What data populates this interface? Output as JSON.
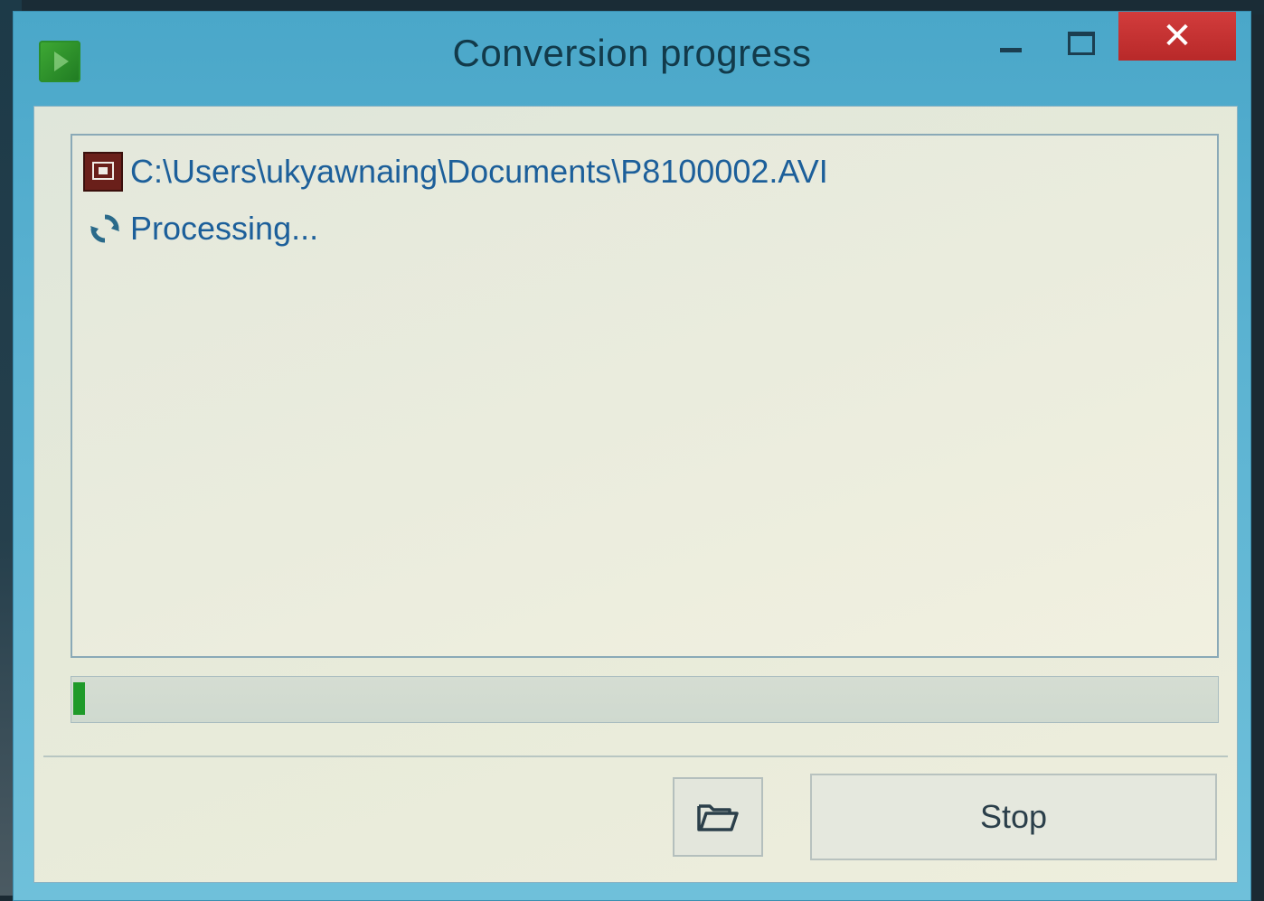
{
  "window": {
    "title": "Conversion progress",
    "close_glyph": "✕"
  },
  "log": {
    "file_path": "C:\\Users\\ukyawnaing\\Documents\\P8100002.AVI",
    "file_icon": "video-file-icon",
    "status_text": "Processing...",
    "status_icon": "refresh-icon"
  },
  "progress": {
    "percent": 1,
    "fill_color": "#1f9a2a"
  },
  "actions": {
    "open_folder_icon": "folder-open-icon",
    "stop_label": "Stop"
  },
  "colors": {
    "title_bar": "#5cb3d2",
    "close_button": "#c83232",
    "link_text": "#1c5f9a"
  }
}
